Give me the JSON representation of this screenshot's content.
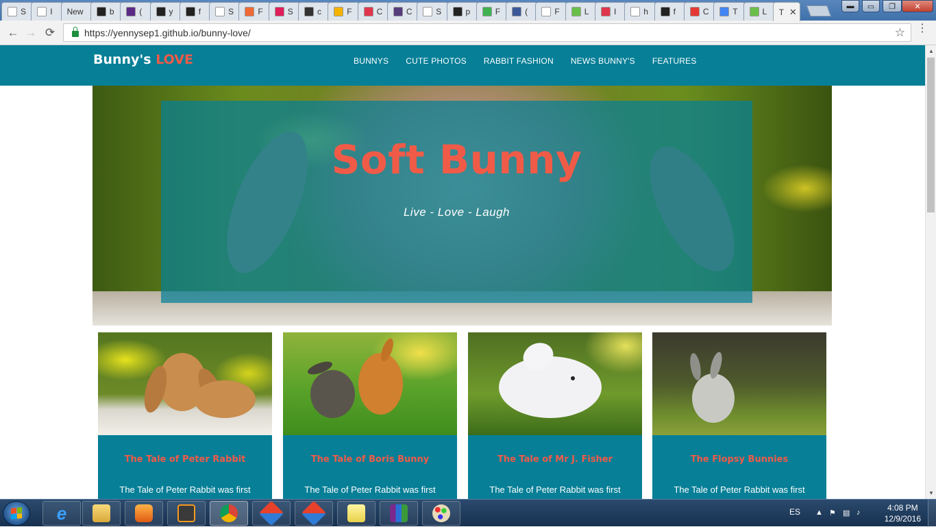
{
  "browser": {
    "tabs": [
      {
        "label": "S",
        "favicon": "doc-icon",
        "color": "#ffffff"
      },
      {
        "label": "I",
        "favicon": "doc-icon",
        "color": "#ffffff"
      },
      {
        "label": "New",
        "favicon": "none",
        "color": "#ffffff"
      },
      {
        "label": "b",
        "favicon": "github-icon",
        "color": "#222222"
      },
      {
        "label": "(",
        "favicon": "mail-icon",
        "color": "#5b2a86"
      },
      {
        "label": "y",
        "favicon": "github-icon",
        "color": "#222222"
      },
      {
        "label": "f",
        "favicon": "flag-icon",
        "color": "#222222"
      },
      {
        "label": "S",
        "favicon": "doc-icon",
        "color": "#ffffff"
      },
      {
        "label": "F",
        "favicon": "blogger-icon",
        "color": "#f06a35"
      },
      {
        "label": "S",
        "favicon": "slack-icon",
        "color": "#e01e5a"
      },
      {
        "label": "c",
        "favicon": "hash-icon",
        "color": "#333333"
      },
      {
        "label": "F",
        "favicon": "note-icon",
        "color": "#f4b400"
      },
      {
        "label": "C",
        "favicon": "m-icon",
        "color": "#e0364d"
      },
      {
        "label": "C",
        "favicon": "b-icon",
        "color": "#563d7c"
      },
      {
        "label": "S",
        "favicon": "doc-icon",
        "color": "#ffffff"
      },
      {
        "label": "p",
        "favicon": "github-icon",
        "color": "#222222"
      },
      {
        "label": "F",
        "favicon": "px-icon",
        "color": "#3fb24f"
      },
      {
        "label": "(",
        "favicon": "facebook-icon",
        "color": "#3b5998"
      },
      {
        "label": "F",
        "favicon": "doc-icon",
        "color": "#ffffff"
      },
      {
        "label": "L",
        "favicon": "e-icon",
        "color": "#6abf4b"
      },
      {
        "label": "I",
        "favicon": "m-icon",
        "color": "#e0364d"
      },
      {
        "label": "h",
        "favicon": "google-icon",
        "color": "#ffffff"
      },
      {
        "label": "f",
        "favicon": "flag-icon",
        "color": "#222222"
      },
      {
        "label": "C",
        "favicon": "f-icon",
        "color": "#e53935"
      },
      {
        "label": "T",
        "favicon": "translate-icon",
        "color": "#4285f4"
      },
      {
        "label": "L",
        "favicon": "e-icon",
        "color": "#6abf4b"
      },
      {
        "label": "T",
        "favicon": "none",
        "color": "#ffffff",
        "active": true
      }
    ],
    "close_glyph": "✕",
    "url": "https://yennysep1.github.io/bunny-love/",
    "back_icon": "←",
    "forward_icon": "→",
    "reload_icon": "⟳",
    "star_icon": "☆",
    "menu_icon": "⋮"
  },
  "site": {
    "brand_main": "Bunny's ",
    "brand_accent": "LOVE",
    "nav": [
      "BUNNYS",
      "CUTE PHOTOS",
      "RABBIT FASHION",
      "NEWS BUNNY'S",
      "FEATURES"
    ],
    "hero_title": "Soft Bunny",
    "hero_subtitle": "Live - Love - Laugh",
    "cards": [
      {
        "title": "The Tale of Peter Rabbit",
        "text": "The Tale of Peter Rabbit was first"
      },
      {
        "title": "The Tale of Boris Bunny",
        "text": "The Tale of Peter Rabbit was first"
      },
      {
        "title": "The Tale of Mr J. Fisher",
        "text": "The Tale of Peter Rabbit was first"
      },
      {
        "title": "The Flopsy Bunnies",
        "text": "The Tale of Peter Rabbit was first"
      }
    ],
    "colors": {
      "teal": "#067f97",
      "coral": "#f05b48"
    }
  },
  "taskbar": {
    "lang": "ES",
    "time": "4:08 PM",
    "date": "12/9/2016"
  }
}
